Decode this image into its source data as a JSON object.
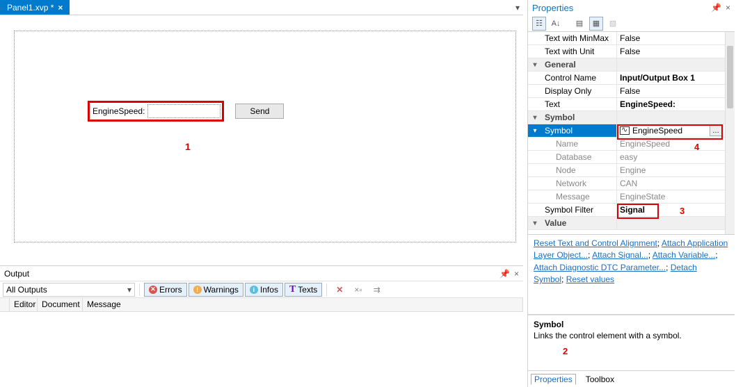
{
  "tab": {
    "title": "Panel1.xvp *"
  },
  "panel": {
    "io_label": "EngineSpeed:",
    "send_label": "Send"
  },
  "annotations": {
    "a1": "1",
    "a2": "2",
    "a3": "3",
    "a4": "4"
  },
  "output": {
    "title": "Output",
    "combo": "All Outputs",
    "filters": {
      "errors": "Errors",
      "warnings": "Warnings",
      "infos": "Infos",
      "texts": "Texts"
    },
    "columns": {
      "editor": "Editor",
      "document": "Document",
      "message": "Message"
    }
  },
  "properties": {
    "title": "Properties",
    "rows": {
      "text_minmax": {
        "name": "Text with MinMax",
        "value": "False"
      },
      "text_unit": {
        "name": "Text with Unit",
        "value": "False"
      },
      "general_cat": "General",
      "control_name": {
        "name": "Control Name",
        "value": "Input/Output Box 1"
      },
      "display_only": {
        "name": "Display Only",
        "value": "False"
      },
      "text": {
        "name": "Text",
        "value": "EngineSpeed:"
      },
      "symbol_cat": "Symbol",
      "symbol": {
        "name": "Symbol",
        "value": "EngineSpeed"
      },
      "sym_name": {
        "name": "Name",
        "value": "EngineSpeed"
      },
      "sym_db": {
        "name": "Database",
        "value": "easy"
      },
      "sym_node": {
        "name": "Node",
        "value": "Engine"
      },
      "sym_net": {
        "name": "Network",
        "value": "CAN"
      },
      "sym_msg": {
        "name": "Message",
        "value": "EngineState"
      },
      "sym_filter": {
        "name": "Symbol Filter",
        "value": "Signal"
      },
      "value_cat": "Value"
    },
    "links": {
      "l1": "Reset Text and Control Alignment",
      "l2": "Attach Application Layer Object...",
      "l3": "Attach Signal...",
      "l4": "Attach Variable...",
      "l5": "Attach Diagnostic DTC Parameter...",
      "l6": "Detach Symbol",
      "l7": "Reset values"
    },
    "desc": {
      "title": "Symbol",
      "text": "Links the control element with a symbol."
    },
    "tabs": {
      "properties": "Properties",
      "toolbox": "Toolbox"
    }
  }
}
